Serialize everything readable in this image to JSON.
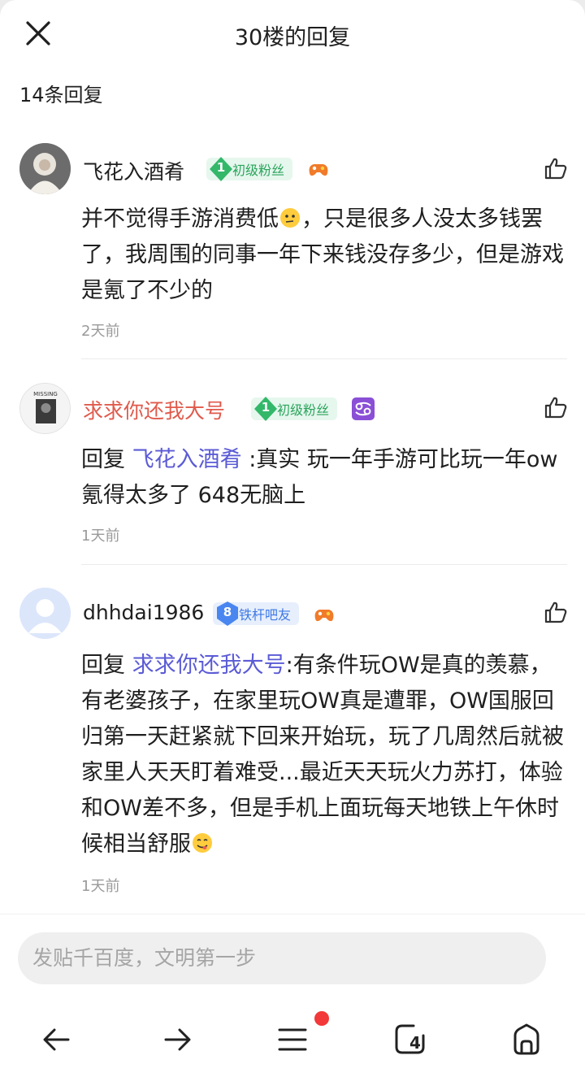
{
  "header": {
    "title": "30楼的回复",
    "close_icon": "close-icon"
  },
  "reply_count": "14条回复",
  "comments": [
    {
      "username": "飞花入酒肴",
      "username_color": "#1f1f1f",
      "level": "1",
      "badge": "初级粉丝",
      "badge_style": "green",
      "extra_icon": "game-controller-icon",
      "text_before": "并不觉得手游消费低",
      "emoji_icon": "thinking-emoji-icon",
      "text_after": "，只是很多人没太多钱罢了，我周围的同事一年下来钱没存多少，但是游戏是氪了不少的",
      "time": "2天前"
    },
    {
      "username": "求求你还我大号",
      "username_color": "#e05a4c",
      "level": "1",
      "badge": "初级粉丝",
      "badge_style": "green",
      "extra_icon": "cancer-zodiac-icon",
      "reply_prefix": "回复",
      "mention": "飞花入酒肴",
      "text": ":真实 玩一年手游可比玩一年ow氪得太多了 648无脑上",
      "time": "1天前"
    },
    {
      "username": "dhhdai1986",
      "username_color": "#1f1f1f",
      "level": "8",
      "badge": "铁杆吧友",
      "badge_style": "blue",
      "extra_icon": "game-controller-icon",
      "reply_prefix": "回复",
      "mention": "求求你还我大号",
      "text": ":有条件玩OW是真的羡慕，有老婆孩子，在家里玩OW真是遭罪，OW国服回归第一天赶紧就下回来开始玩，玩了几周然后就被家里人天天盯着难受...最近天天玩火力苏打，体验和OW差不多，但是手机上面玩每天地铁上午休时候相当舒服",
      "emoji_icon": "yum-emoji-icon",
      "time": "1天前"
    }
  ],
  "composer": {
    "placeholder": "发贴千百度，文明第一步"
  },
  "bottom_nav": [
    "back-arrow-icon",
    "forward-arrow-icon",
    "menu-icon",
    "tabs-icon",
    "home-icon"
  ],
  "colors": {
    "mention": "#5b5bd6",
    "badge_green": "#2aa45b",
    "badge_blue": "#3c78e4",
    "notification_dot": "#f23838"
  },
  "tabs_count": "4"
}
